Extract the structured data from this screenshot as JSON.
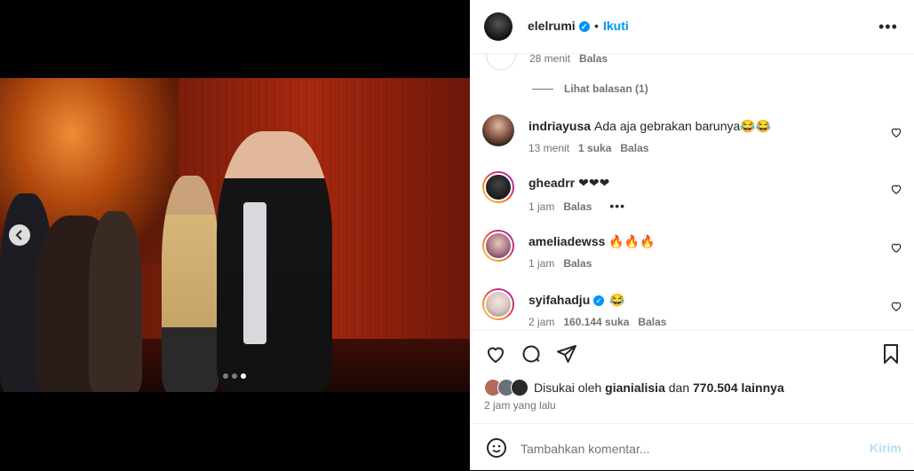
{
  "header": {
    "username": "elelrumi",
    "separator": "•",
    "follow_label": "Ikuti",
    "more_label": "•••"
  },
  "top_comment": {
    "time": "28 menit",
    "reply_label": "Balas",
    "view_replies": "Lihat balasan (1)"
  },
  "comments": [
    {
      "username": "indriayusa",
      "text": "Ada aja gebrakan barunya😂😂",
      "time": "13 menit",
      "likes": "1 suka",
      "reply_label": "Balas",
      "ring": false,
      "verified": false
    },
    {
      "username": "gheadrr",
      "text": "❤❤❤",
      "time": "1 jam",
      "likes": "",
      "reply_label": "Balas",
      "ring": true,
      "verified": false
    },
    {
      "username": "ameliadewss",
      "text": "🔥🔥🔥",
      "time": "1 jam",
      "likes": "",
      "reply_label": "Balas",
      "ring": true,
      "verified": false
    },
    {
      "username": "syifahadju",
      "text": "😂",
      "time": "2 jam",
      "likes": "160.144 suka",
      "reply_label": "Balas",
      "ring": true,
      "verified": true
    }
  ],
  "likes": {
    "prefix": "Disukai oleh",
    "user": "gianialisia",
    "middle": "dan",
    "count": "770.504 lainnya"
  },
  "post_time": "2 jam yang lalu",
  "compose": {
    "placeholder": "Tambahkan komentar...",
    "send_label": "Kirim"
  },
  "carousel": {
    "total": 3,
    "active": 3
  },
  "colors": {
    "accent": "#0095f6",
    "send_disabled": "#b2dffc",
    "text": "#262626",
    "muted": "#737373"
  },
  "icons": [
    "heart-icon",
    "comment-icon",
    "share-icon",
    "bookmark-icon",
    "emoji-icon",
    "chevron-left-icon",
    "more-icon",
    "verified-icon"
  ]
}
